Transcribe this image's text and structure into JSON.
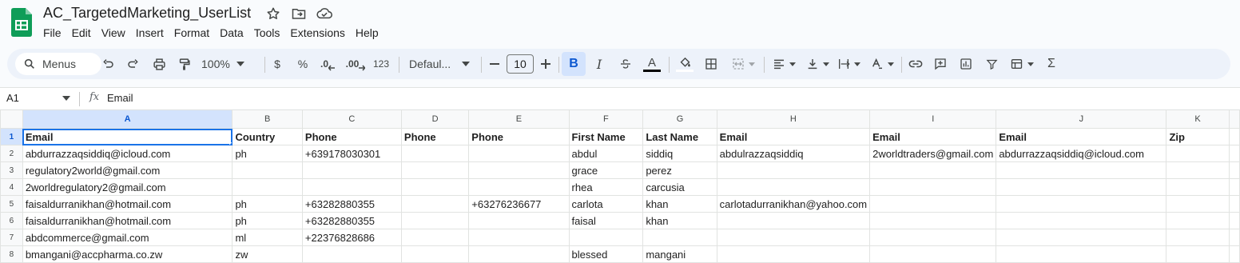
{
  "app": {
    "doc_title": "AC_TargetedMarketing_UserList",
    "menu": [
      "File",
      "Edit",
      "View",
      "Insert",
      "Format",
      "Data",
      "Tools",
      "Extensions",
      "Help"
    ]
  },
  "toolbar": {
    "search_label": "Menus",
    "zoom": "100%",
    "currency": "$",
    "percent": "%",
    "decimal_decrease": ".0",
    "decimal_increase": ".00",
    "number_format": "123",
    "font_family": "Defaul...",
    "font_size": "10",
    "bold": "B",
    "italic": "I",
    "text_color_letter": "A",
    "sum": "Σ"
  },
  "formula_bar": {
    "cell_ref": "A1",
    "fx": "fx",
    "value": "Email"
  },
  "sheet": {
    "columns": [
      "A",
      "B",
      "C",
      "D",
      "E",
      "F",
      "G",
      "H",
      "I",
      "J",
      "K"
    ],
    "rows": [
      {
        "num": "1",
        "cells": [
          "Email",
          "Country",
          "Phone",
          "Phone",
          "Phone",
          "First Name",
          "Last Name",
          "Email",
          "Email",
          "Email",
          "Zip"
        ]
      },
      {
        "num": "2",
        "cells": [
          "abdurrazzaqsiddiq@icloud.com",
          "ph",
          "+639178030301",
          "",
          "",
          "abdul",
          "siddiq",
          "abdulrazzaqsiddiq",
          "2worldtraders@gmail.com",
          "abdurrazzaqsiddiq@icloud.com",
          ""
        ]
      },
      {
        "num": "3",
        "cells": [
          "regulatory2world@gmail.com",
          "",
          "",
          "",
          "",
          "grace",
          "perez",
          "",
          "",
          "",
          ""
        ]
      },
      {
        "num": "4",
        "cells": [
          "2worldregulatory2@gmail.com",
          "",
          "",
          "",
          "",
          "rhea",
          "carcusia",
          "",
          "",
          "",
          ""
        ]
      },
      {
        "num": "5",
        "cells": [
          "faisaldurranikhan@hotmail.com",
          "ph",
          "+63282880355",
          "",
          "+63276236677",
          "carlota",
          "khan",
          "carlotadurranikhan@yahoo.com",
          "",
          "",
          ""
        ]
      },
      {
        "num": "6",
        "cells": [
          "faisaldurranikhan@hotmail.com",
          "ph",
          "+63282880355",
          "",
          "",
          "faisal",
          "khan",
          "",
          "",
          "",
          ""
        ]
      },
      {
        "num": "7",
        "cells": [
          "abdcommerce@gmail.com",
          "ml",
          "+22376828686",
          "",
          "",
          "",
          "",
          "",
          "",
          "",
          ""
        ]
      },
      {
        "num": "8",
        "cells": [
          "bmangani@accpharma.co.zw",
          "zw",
          "",
          "",
          "",
          "blessed",
          "mangani",
          "",
          "",
          "",
          ""
        ]
      }
    ]
  },
  "colors": {
    "accent": "#1a73e8",
    "sheets_green": "#0f9d58",
    "toolbar_bg": "#edf2fa",
    "selected_header_bg": "#d3e3fd"
  }
}
